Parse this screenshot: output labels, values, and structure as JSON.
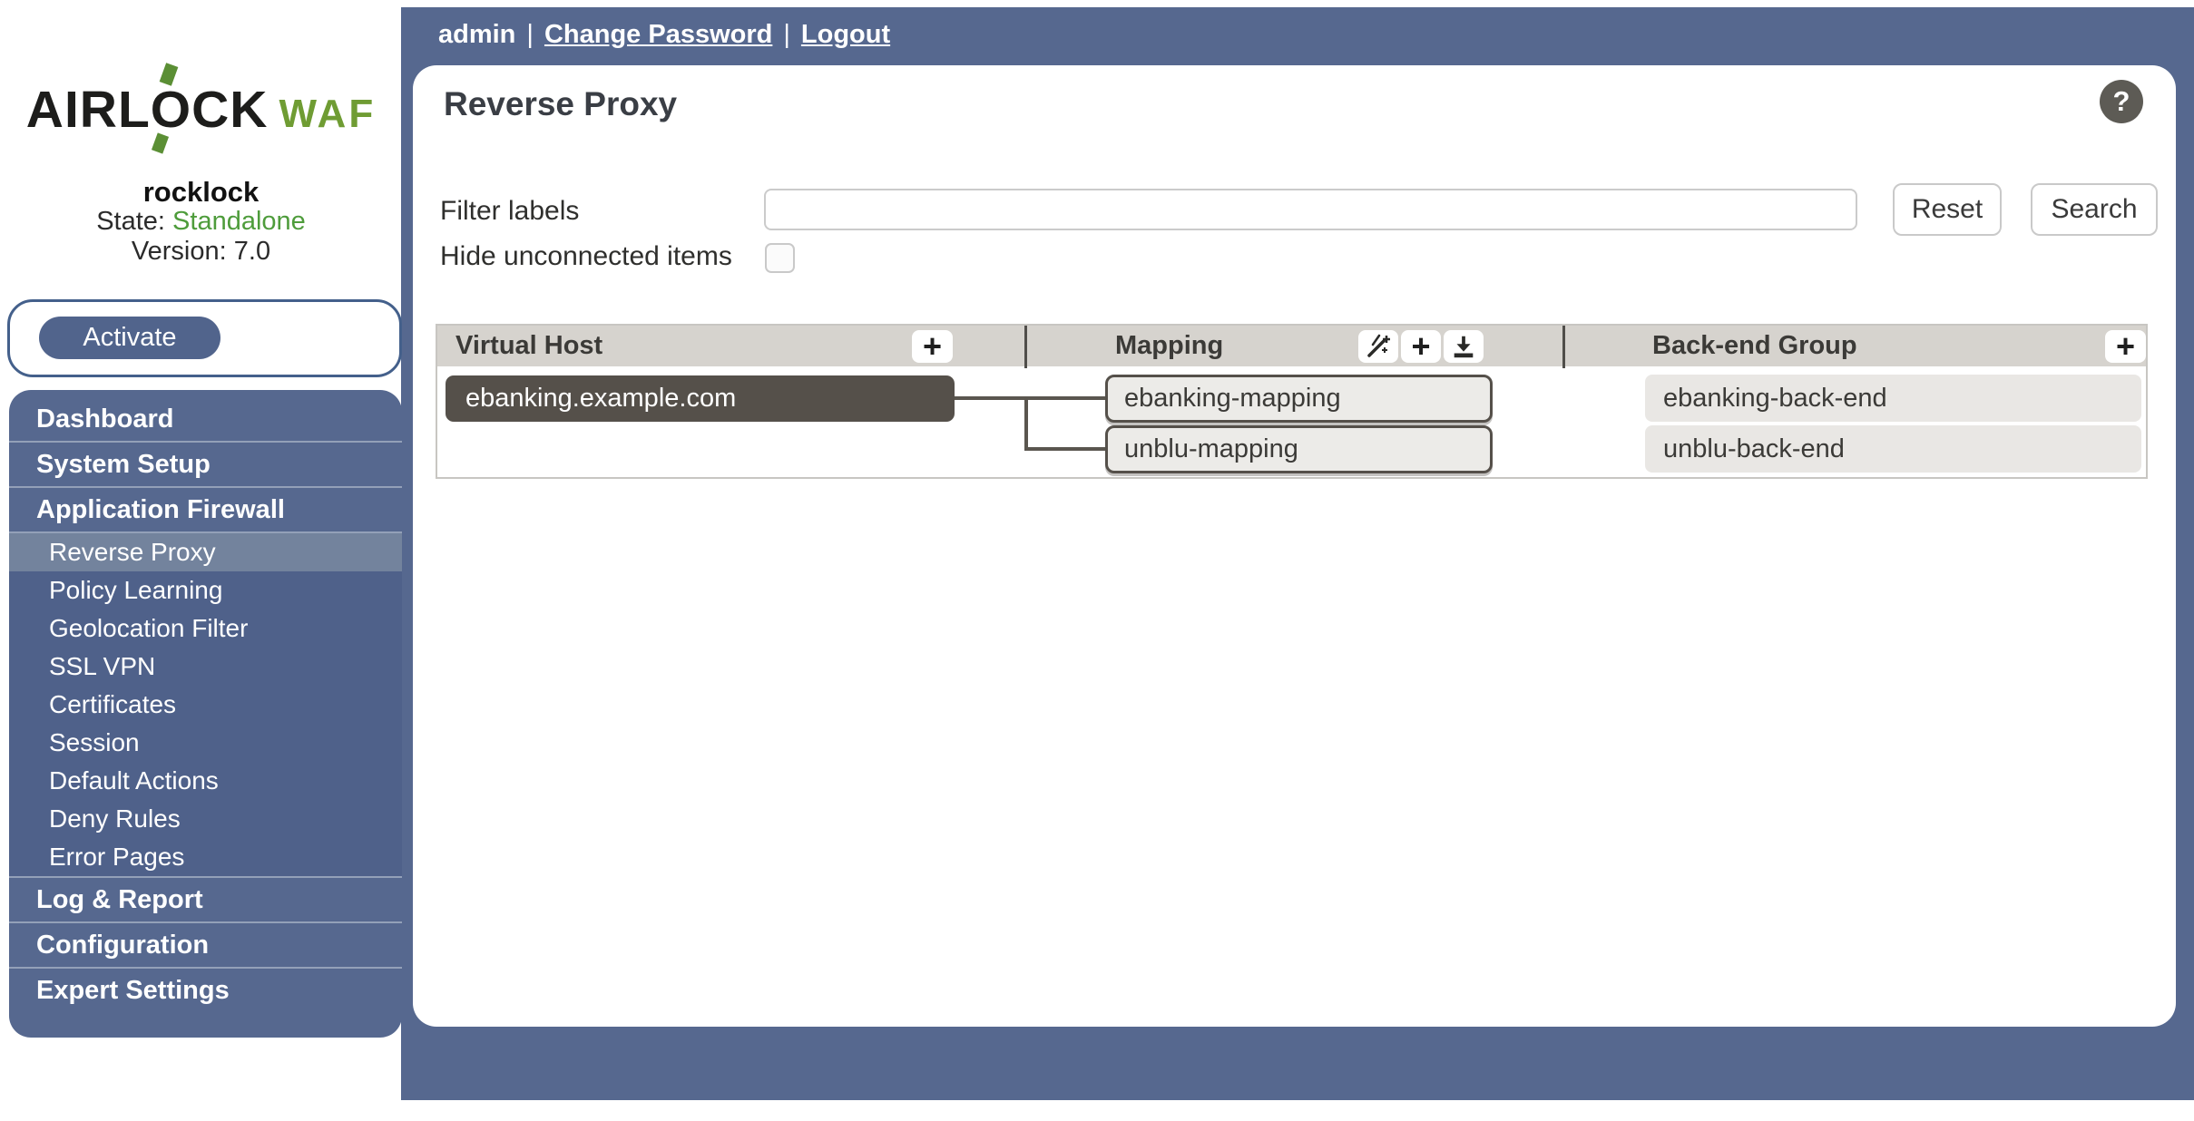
{
  "colors": {
    "backdrop_blue": "#56688F",
    "submenu_blue": "#4F618A",
    "selected_item_blue": "#73839D",
    "brand_green": "#6F9C33",
    "state_green": "#4E9C3B",
    "node_dark": "#55504A",
    "table_header_gray": "#D6D3CE"
  },
  "topbar": {
    "username": "admin",
    "separator": "|",
    "links": [
      {
        "label": "Change Password"
      },
      {
        "label": "Logout"
      }
    ]
  },
  "branding": {
    "logo_prefix": "AIRL",
    "logo_o": "O",
    "logo_suffix": "CK",
    "logo_product": "WAF",
    "hostname": "rocklock",
    "state_label": "State:",
    "state_value": "Standalone",
    "version_label": "Version:",
    "version_value": "7.0"
  },
  "activate": {
    "label": "Activate"
  },
  "sidebar": {
    "items": [
      {
        "label": "Dashboard",
        "type": "section",
        "selected": false
      },
      {
        "label": "System Setup",
        "type": "section",
        "selected": false
      },
      {
        "label": "Application Firewall",
        "type": "section",
        "selected": false
      },
      {
        "label": "Reverse Proxy",
        "type": "sub",
        "selected": true
      },
      {
        "label": "Policy Learning",
        "type": "sub",
        "selected": false
      },
      {
        "label": "Geolocation Filter",
        "type": "sub",
        "selected": false
      },
      {
        "label": "SSL VPN",
        "type": "sub",
        "selected": false
      },
      {
        "label": "Certificates",
        "type": "sub",
        "selected": false
      },
      {
        "label": "Session",
        "type": "sub",
        "selected": false
      },
      {
        "label": "Default Actions",
        "type": "sub",
        "selected": false
      },
      {
        "label": "Deny Rules",
        "type": "sub",
        "selected": false
      },
      {
        "label": "Error Pages",
        "type": "sub",
        "selected": false
      },
      {
        "label": "Log & Report",
        "type": "section",
        "selected": false
      },
      {
        "label": "Configuration",
        "type": "section",
        "selected": false
      },
      {
        "label": "Expert Settings",
        "type": "section",
        "selected": false
      }
    ]
  },
  "page": {
    "title": "Reverse Proxy",
    "help_glyph": "?"
  },
  "filter": {
    "label": "Filter labels",
    "value": "",
    "hide_label": "Hide unconnected items",
    "hide_checked": false,
    "reset_label": "Reset",
    "search_label": "Search"
  },
  "board": {
    "plus_glyph": "+",
    "columns": [
      {
        "label": "Virtual Host",
        "actions": [
          "add"
        ]
      },
      {
        "label": "Mapping",
        "actions": [
          "auto-mapping-wand",
          "add",
          "import-download"
        ]
      },
      {
        "label": "Back-end Group",
        "actions": [
          "add"
        ]
      }
    ],
    "virtual_hosts": [
      {
        "name": "ebanking.example.com"
      }
    ],
    "mappings": [
      {
        "name": "ebanking-mapping"
      },
      {
        "name": "unblu-mapping"
      }
    ],
    "backend_groups": [
      {
        "name": "ebanking-back-end"
      },
      {
        "name": "unblu-back-end"
      }
    ],
    "connections": [
      {
        "from": "ebanking.example.com",
        "to": "ebanking-mapping"
      },
      {
        "from": "ebanking.example.com",
        "to": "unblu-mapping"
      }
    ]
  }
}
